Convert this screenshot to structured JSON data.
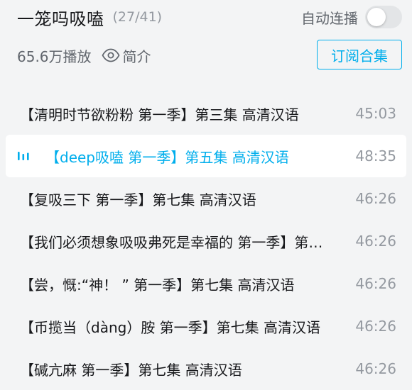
{
  "header": {
    "title": "一笼吗吸嗑",
    "progress": "(27/41)",
    "autoplay_label": "自动连播",
    "autoplay_on": false,
    "play_count": "65.6万播放",
    "intro_label": "简介",
    "subscribe_label": "订阅合集"
  },
  "colors": {
    "accent": "#00aeec",
    "background": "#f3f4f5",
    "active_row": "#ffffff"
  },
  "episodes": [
    {
      "title": "【清明时节欲粉粉 第一季】第三集 高清汉语",
      "duration": "45:03",
      "active": false
    },
    {
      "title": "【deep吸嗑 第一季】第五集 高清汉语",
      "duration": "48:35",
      "active": true
    },
    {
      "title": "【复吸三下 第一季】第七集 高清汉语",
      "duration": "46:26",
      "active": false
    },
    {
      "title": "【我们必须想象吸吸弗死是幸福的 第一季】第七集 高清汉语",
      "duration": "46:26",
      "active": false
    },
    {
      "title": "【尝，慨:“神！ ” 第一季】第七集 高清汉语",
      "duration": "46:26",
      "active": false
    },
    {
      "title": "【币揽当（dàng）胺 第一季】第七集 高清汉语",
      "duration": "46:26",
      "active": false
    },
    {
      "title": "【碱亢麻 第一季】第七集 高清汉语",
      "duration": "46:26",
      "active": false
    }
  ]
}
